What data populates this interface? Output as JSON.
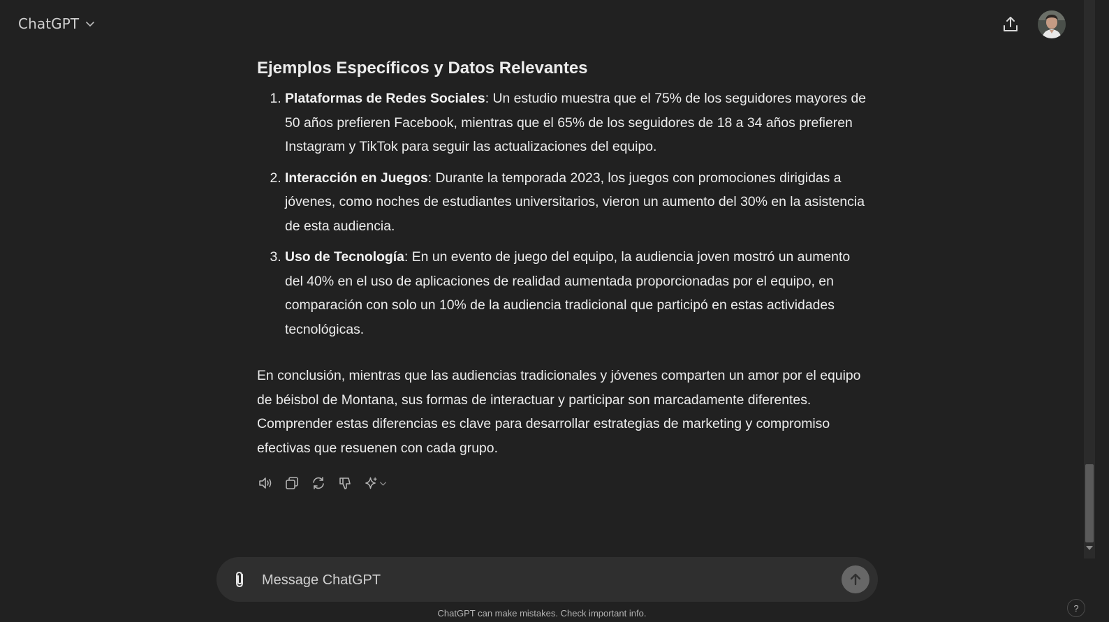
{
  "header": {
    "model_name": "ChatGPT"
  },
  "response": {
    "heading": "Ejemplos Específicos y Datos Relevantes",
    "items": [
      {
        "title": "Plataformas de Redes Sociales",
        "text": ": Un estudio muestra que el 75% de los seguidores mayores de 50 años prefieren Facebook, mientras que el 65% de los seguidores de 18 a 34 años prefieren Instagram y TikTok para seguir las actualizaciones del equipo."
      },
      {
        "title": "Interacción en Juegos",
        "text": ": Durante la temporada 2023, los juegos con promociones dirigidas a jóvenes, como noches de estudiantes universitarios, vieron un aumento del 30% en la asistencia de esta audiencia."
      },
      {
        "title": "Uso de Tecnología",
        "text": ": En un evento de juego del equipo, la audiencia joven mostró un aumento del 40% en el uso de aplicaciones de realidad aumentada proporcionadas por el equipo, en comparación con solo un 10% de la audiencia tradicional que participó en estas actividades tecnológicas."
      }
    ],
    "conclusion": "En conclusión, mientras que las audiencias tradicionales y jóvenes comparten un amor por el equipo de béisbol de Montana, sus formas de interactuar y participar son marcadamente diferentes. Comprender estas diferencias es clave para desarrollar estrategias de marketing y compromiso efectivas que resuenen con cada grupo."
  },
  "actions": {
    "icons": [
      "speaker-icon",
      "copy-icon",
      "regenerate-icon",
      "thumbs-down-icon",
      "sparkle-icon"
    ]
  },
  "composer": {
    "placeholder": "Message ChatGPT"
  },
  "footer": {
    "note": "ChatGPT can make mistakes. Check important info.",
    "help_label": "?"
  },
  "colors": {
    "background": "#212121",
    "composer_bg": "#2f2f2f",
    "text": "#ececec",
    "send_button": "#676767"
  }
}
